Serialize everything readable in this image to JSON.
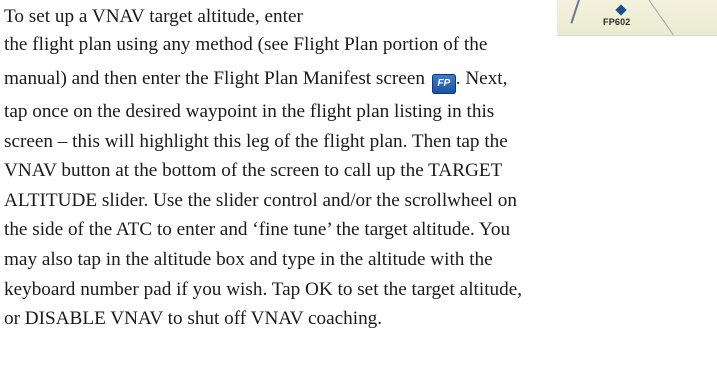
{
  "map_fragment": {
    "waypoint_label": "FP602"
  },
  "icons": {
    "flight_plan_manifest": {
      "name": "flight-plan-manifest-icon",
      "glyph": "FP",
      "color": "#2a66bf"
    }
  },
  "paragraph": {
    "lines": [
      "To set up a VNAV target altitude, enter",
      "the flight plan using any method (see Flight Plan portion of the",
      "manual) and then enter the Flight Plan Manifest screen",
      ". Next,",
      "tap once on the desired waypoint in the flight plan listing in this",
      "screen – this will highlight this leg of the flight plan. Then tap the",
      "VNAV button at the bottom of the screen to call up the TARGET",
      "ALTITUDE slider. Use the slider control and/or the scrollwheel on",
      "the side of the ATC to enter and ‘fine tune’ the target altitude. You",
      "may also tap in the altitude box and type in the altitude with the",
      "keyboard number pad if you wish. Tap OK to set the target altitude,",
      "or DISABLE VNAV to shut off VNAV coaching."
    ]
  }
}
